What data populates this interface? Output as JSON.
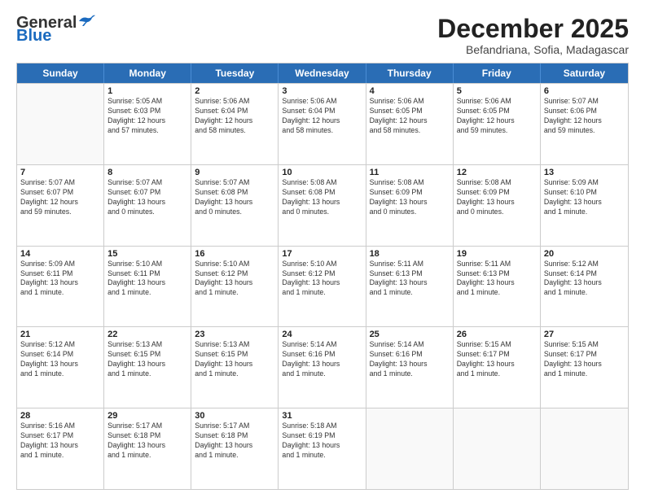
{
  "logo": {
    "general": "General",
    "blue": "Blue"
  },
  "title": "December 2025",
  "subtitle": "Befandriana, Sofia, Madagascar",
  "header_days": [
    "Sunday",
    "Monday",
    "Tuesday",
    "Wednesday",
    "Thursday",
    "Friday",
    "Saturday"
  ],
  "weeks": [
    [
      {
        "day": "",
        "info": ""
      },
      {
        "day": "1",
        "info": "Sunrise: 5:05 AM\nSunset: 6:03 PM\nDaylight: 12 hours\nand 57 minutes."
      },
      {
        "day": "2",
        "info": "Sunrise: 5:06 AM\nSunset: 6:04 PM\nDaylight: 12 hours\nand 58 minutes."
      },
      {
        "day": "3",
        "info": "Sunrise: 5:06 AM\nSunset: 6:04 PM\nDaylight: 12 hours\nand 58 minutes."
      },
      {
        "day": "4",
        "info": "Sunrise: 5:06 AM\nSunset: 6:05 PM\nDaylight: 12 hours\nand 58 minutes."
      },
      {
        "day": "5",
        "info": "Sunrise: 5:06 AM\nSunset: 6:05 PM\nDaylight: 12 hours\nand 59 minutes."
      },
      {
        "day": "6",
        "info": "Sunrise: 5:07 AM\nSunset: 6:06 PM\nDaylight: 12 hours\nand 59 minutes."
      }
    ],
    [
      {
        "day": "7",
        "info": "Sunrise: 5:07 AM\nSunset: 6:07 PM\nDaylight: 12 hours\nand 59 minutes."
      },
      {
        "day": "8",
        "info": "Sunrise: 5:07 AM\nSunset: 6:07 PM\nDaylight: 13 hours\nand 0 minutes."
      },
      {
        "day": "9",
        "info": "Sunrise: 5:07 AM\nSunset: 6:08 PM\nDaylight: 13 hours\nand 0 minutes."
      },
      {
        "day": "10",
        "info": "Sunrise: 5:08 AM\nSunset: 6:08 PM\nDaylight: 13 hours\nand 0 minutes."
      },
      {
        "day": "11",
        "info": "Sunrise: 5:08 AM\nSunset: 6:09 PM\nDaylight: 13 hours\nand 0 minutes."
      },
      {
        "day": "12",
        "info": "Sunrise: 5:08 AM\nSunset: 6:09 PM\nDaylight: 13 hours\nand 0 minutes."
      },
      {
        "day": "13",
        "info": "Sunrise: 5:09 AM\nSunset: 6:10 PM\nDaylight: 13 hours\nand 1 minute."
      }
    ],
    [
      {
        "day": "14",
        "info": "Sunrise: 5:09 AM\nSunset: 6:11 PM\nDaylight: 13 hours\nand 1 minute."
      },
      {
        "day": "15",
        "info": "Sunrise: 5:10 AM\nSunset: 6:11 PM\nDaylight: 13 hours\nand 1 minute."
      },
      {
        "day": "16",
        "info": "Sunrise: 5:10 AM\nSunset: 6:12 PM\nDaylight: 13 hours\nand 1 minute."
      },
      {
        "day": "17",
        "info": "Sunrise: 5:10 AM\nSunset: 6:12 PM\nDaylight: 13 hours\nand 1 minute."
      },
      {
        "day": "18",
        "info": "Sunrise: 5:11 AM\nSunset: 6:13 PM\nDaylight: 13 hours\nand 1 minute."
      },
      {
        "day": "19",
        "info": "Sunrise: 5:11 AM\nSunset: 6:13 PM\nDaylight: 13 hours\nand 1 minute."
      },
      {
        "day": "20",
        "info": "Sunrise: 5:12 AM\nSunset: 6:14 PM\nDaylight: 13 hours\nand 1 minute."
      }
    ],
    [
      {
        "day": "21",
        "info": "Sunrise: 5:12 AM\nSunset: 6:14 PM\nDaylight: 13 hours\nand 1 minute."
      },
      {
        "day": "22",
        "info": "Sunrise: 5:13 AM\nSunset: 6:15 PM\nDaylight: 13 hours\nand 1 minute."
      },
      {
        "day": "23",
        "info": "Sunrise: 5:13 AM\nSunset: 6:15 PM\nDaylight: 13 hours\nand 1 minute."
      },
      {
        "day": "24",
        "info": "Sunrise: 5:14 AM\nSunset: 6:16 PM\nDaylight: 13 hours\nand 1 minute."
      },
      {
        "day": "25",
        "info": "Sunrise: 5:14 AM\nSunset: 6:16 PM\nDaylight: 13 hours\nand 1 minute."
      },
      {
        "day": "26",
        "info": "Sunrise: 5:15 AM\nSunset: 6:17 PM\nDaylight: 13 hours\nand 1 minute."
      },
      {
        "day": "27",
        "info": "Sunrise: 5:15 AM\nSunset: 6:17 PM\nDaylight: 13 hours\nand 1 minute."
      }
    ],
    [
      {
        "day": "28",
        "info": "Sunrise: 5:16 AM\nSunset: 6:17 PM\nDaylight: 13 hours\nand 1 minute."
      },
      {
        "day": "29",
        "info": "Sunrise: 5:17 AM\nSunset: 6:18 PM\nDaylight: 13 hours\nand 1 minute."
      },
      {
        "day": "30",
        "info": "Sunrise: 5:17 AM\nSunset: 6:18 PM\nDaylight: 13 hours\nand 1 minute."
      },
      {
        "day": "31",
        "info": "Sunrise: 5:18 AM\nSunset: 6:19 PM\nDaylight: 13 hours\nand 1 minute."
      },
      {
        "day": "",
        "info": ""
      },
      {
        "day": "",
        "info": ""
      },
      {
        "day": "",
        "info": ""
      }
    ]
  ]
}
